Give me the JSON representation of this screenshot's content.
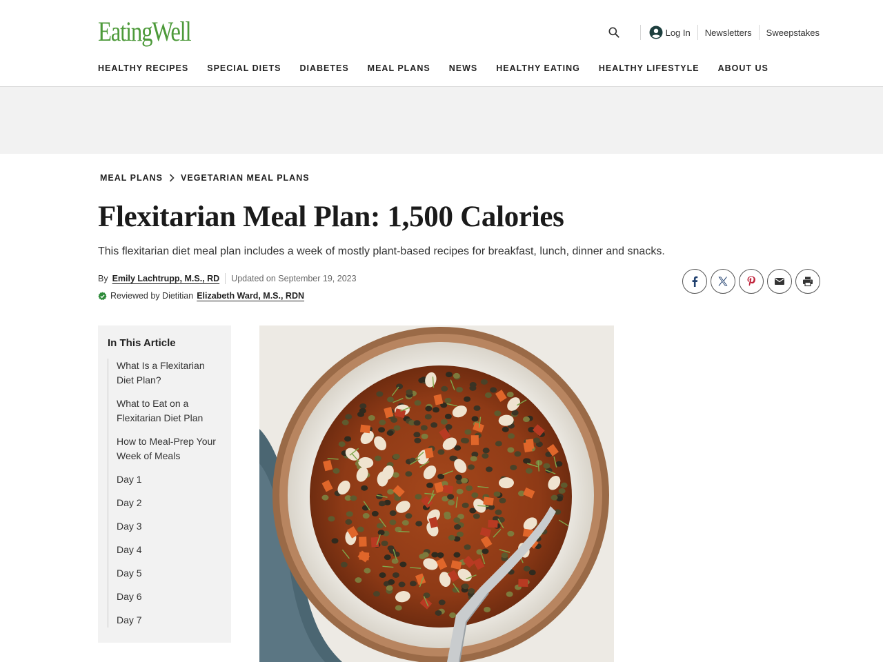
{
  "brand": {
    "logo_text": "EatingWell",
    "color": "#4d9a3a"
  },
  "utility": {
    "search_icon": "search-icon",
    "login_label": "Log In",
    "newsletters_label": "Newsletters",
    "sweepstakes_label": "Sweepstakes"
  },
  "nav": {
    "items": [
      "HEALTHY RECIPES",
      "SPECIAL DIETS",
      "DIABETES",
      "MEAL PLANS",
      "NEWS",
      "HEALTHY EATING",
      "HEALTHY LIFESTYLE",
      "ABOUT US"
    ]
  },
  "breadcrumb": {
    "items": [
      "MEAL PLANS",
      "VEGETARIAN MEAL PLANS"
    ]
  },
  "article": {
    "title": "Flexitarian Meal Plan: 1,500 Calories",
    "subtitle": "This flexitarian diet meal plan includes a week of mostly plant-based recipes for breakfast, lunch, dinner and snacks.",
    "by_label": "By",
    "author": "Emily Lachtrupp, M.S., RD",
    "updated": "Updated on September 19, 2023",
    "reviewed_label": "Reviewed by Dietitian",
    "reviewer": "Elizabeth Ward, M.S., RDN"
  },
  "share": {
    "icons": [
      "facebook-icon",
      "x-icon",
      "pinterest-icon",
      "email-icon",
      "print-icon"
    ],
    "icon_color": "#1f3f6e",
    "pinterest_color": "#c0223a"
  },
  "toc": {
    "title": "In This Article",
    "items": [
      "What Is a Flexitarian Diet Plan?",
      "What to Eat on a Flexitarian Diet Plan",
      "How to Meal-Prep Your Week of Meals",
      "Day 1",
      "Day 2",
      "Day 3",
      "Day 4",
      "Day 5",
      "Day 6",
      "Day 7"
    ]
  }
}
